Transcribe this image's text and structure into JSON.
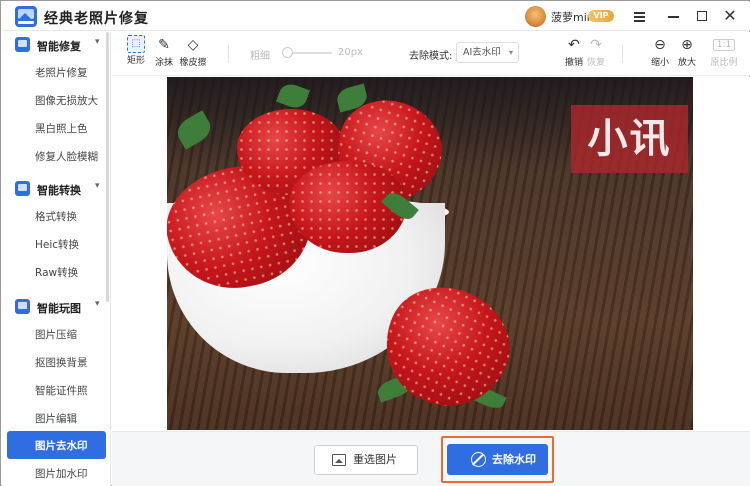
{
  "app": {
    "title": "经典老照片修复",
    "user": {
      "name": "菠萝mir",
      "badge": "VIP"
    }
  },
  "sidebar": {
    "sections": [
      {
        "label": "智能修复",
        "items": [
          "老照片修复",
          "图像无损放大",
          "黑白照上色",
          "修复人脸模糊"
        ]
      },
      {
        "label": "智能转换",
        "items": [
          "格式转换",
          "Heic转换",
          "Raw转换"
        ]
      },
      {
        "label": "智能玩图",
        "items": [
          "图片压缩",
          "抠图换背景",
          "智能证件照",
          "图片编辑",
          "图片去水印",
          "图片加水印"
        ]
      }
    ],
    "active_item": "图片去水印"
  },
  "toolbar": {
    "tools": [
      {
        "label": "矩形",
        "icon": "rectangle-select-icon",
        "selected": true
      },
      {
        "label": "涂抹",
        "icon": "brush-icon",
        "selected": false
      },
      {
        "label": "橡皮擦",
        "icon": "eraser-icon",
        "selected": false
      }
    ],
    "brush_label": "粗细",
    "brush_size": "20px",
    "brush_slider_value": 0,
    "mode_label": "去除模式:",
    "mode_value": "AI去水印",
    "undo": "撤销",
    "redo": "恢复",
    "zoom_out": "缩小",
    "zoom_in": "放大",
    "original_ratio": "原比例",
    "original_ratio_icon": "1:1"
  },
  "canvas": {
    "watermark_text": "小讯"
  },
  "actions": {
    "reselect": "重选图片",
    "remove": "去除水印"
  },
  "colors": {
    "accent": "#2f6de1",
    "highlight": "#ec6a2c",
    "watermark": "#af282d"
  }
}
